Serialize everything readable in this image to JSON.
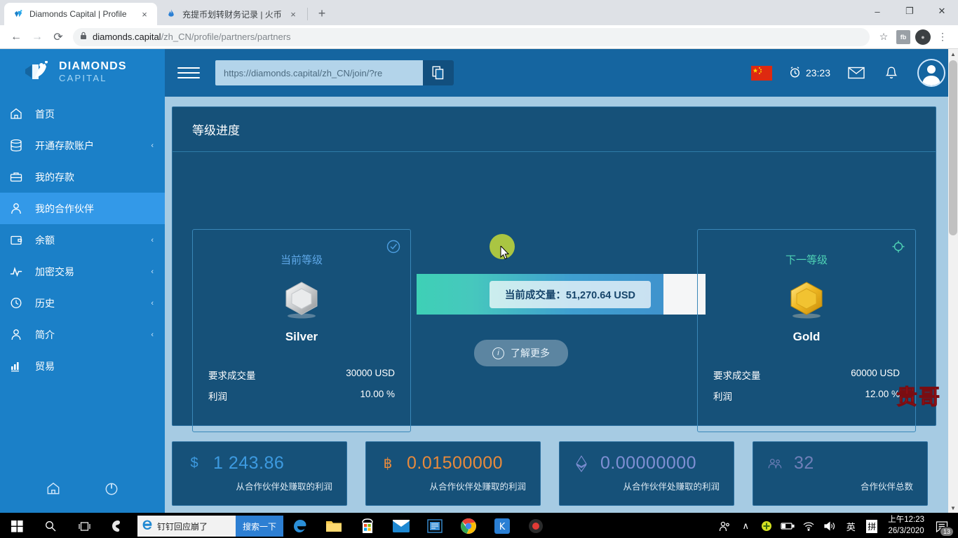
{
  "browser": {
    "tabs": [
      {
        "title": "Diamonds Capital | Profile",
        "favicon": "diamonds-logo-icon",
        "active": true,
        "close_label": "×"
      },
      {
        "title": "充提币划转财务记录 | 火币全球站",
        "favicon": "huobi-flame-icon",
        "active": false,
        "close_label": "×"
      }
    ],
    "new_tab_label": "+",
    "window_controls": {
      "minimize": "–",
      "maximize": "❐",
      "close": "✕"
    },
    "toolbar": {
      "back": "←",
      "forward": "→",
      "reload": "⟳",
      "lock": "🔒",
      "url_domain": "diamonds.capital",
      "url_path": "/zh_CN/profile/partners/partners",
      "bookmark_star": "☆",
      "extension_label": "fb",
      "menu_dots": "⋮"
    }
  },
  "sidebar": {
    "brand": {
      "line1": "DIAMONDS",
      "line2": "CAPITAL"
    },
    "items": [
      {
        "label": "首页",
        "icon": "home-icon",
        "chevron": "",
        "active": false
      },
      {
        "label": "开通存款账户",
        "icon": "database-icon",
        "chevron": "‹",
        "active": false
      },
      {
        "label": "我的存款",
        "icon": "briefcase-icon",
        "chevron": "",
        "active": false
      },
      {
        "label": "我的合作伙伴",
        "icon": "user-icon",
        "chevron": "",
        "active": true
      },
      {
        "label": "余额",
        "icon": "wallet-icon",
        "chevron": "‹",
        "active": false
      },
      {
        "label": "加密交易",
        "icon": "pulse-icon",
        "chevron": "‹",
        "active": false
      },
      {
        "label": "历史",
        "icon": "clock-icon",
        "chevron": "‹",
        "active": false
      },
      {
        "label": "简介",
        "icon": "profile-icon",
        "chevron": "‹",
        "active": false
      },
      {
        "label": "贸易",
        "icon": "chart-bars-icon",
        "chevron": "",
        "active": false
      }
    ],
    "footer": {
      "home_icon": "home-outline-icon",
      "power_icon": "power-icon"
    }
  },
  "topbar": {
    "menu_toggle": "hamburger-icon",
    "referral_link_value": "https://diamonds.capital/zh_CN/join/?re",
    "referral_link_placeholder": "https://diamonds.capital/zh_CN/join/?re",
    "copy_icon": "copy-icon",
    "flag": "cn-flag-icon",
    "clock_icon": "alarm-clock-icon",
    "clock_time": "23:23",
    "mail_icon": "envelope-icon",
    "bell_icon": "bell-icon",
    "avatar_icon": "user-avatar-icon"
  },
  "panel": {
    "title": "等级进度",
    "current_tier": {
      "kicker": "当前等级",
      "name": "Silver",
      "badge_icon": "check-circle-icon",
      "medal_icon": "silver-hex-medal-icon",
      "rows": [
        {
          "label": "要求成交量",
          "value": "30000 USD"
        },
        {
          "label": "利润",
          "value": "10.00 %"
        }
      ]
    },
    "next_tier": {
      "kicker": "下一等级",
      "name": "Gold",
      "badge_icon": "target-circle-icon",
      "medal_icon": "gold-hex-medal-icon",
      "rows": [
        {
          "label": "要求成交量",
          "value": "60000 USD"
        },
        {
          "label": "利润",
          "value": "12.00 %"
        }
      ]
    },
    "progress": {
      "pill_text": "当前成交量：51,270.64 USD",
      "current_volume": 51270.64,
      "min_volume": 30000,
      "max_volume": 60000,
      "percent": 85
    },
    "learn_more": {
      "label": "了解更多",
      "icon": "info-icon"
    }
  },
  "stats": [
    {
      "symbol": "$",
      "symbol_icon": "usd-icon",
      "value": "1 243.86",
      "caption": "从合作伙伴处赚取的利润",
      "color": "#3d9ae0"
    },
    {
      "symbol": "฿",
      "symbol_icon": "btc-icon",
      "value": "0.01500000",
      "caption": "从合作伙伴处赚取的利润",
      "color": "#e88a3c"
    },
    {
      "symbol": "⟠",
      "symbol_icon": "eth-icon",
      "value": "0.00000000",
      "caption": "从合作伙伴处赚取的利润",
      "color": "#7f8fd4"
    },
    {
      "symbol": "👥",
      "symbol_icon": "users-icon",
      "value": "32",
      "caption": "合作伙伴总数",
      "color": "#6f7fb8"
    }
  ],
  "watermark": "贵哥",
  "taskbar": {
    "start_icon": "windows-start-icon",
    "search_icon": "search-icon",
    "taskview_icon": "task-view-icon",
    "cortana_icon": "swirl-icon",
    "search_box": {
      "icon": "ie-icon",
      "text": "钉钉回应崩了",
      "go_label": "搜索一下"
    },
    "pinned": [
      "edge-icon",
      "file-explorer-icon",
      "store-icon",
      "mail-icon",
      "office-icon",
      "chrome-icon",
      "kingsoft-icon",
      "recorder-icon"
    ],
    "tray": {
      "people_icon": "people-icon",
      "chevron_icon": "∧",
      "shield_icon": "security-icon",
      "battery_icon": "battery-icon",
      "wifi_icon": "wifi-icon",
      "volume_icon": "volume-icon",
      "ime_lang": "英",
      "ime_mode": "拼",
      "time": "上午12:23",
      "date": "26/3/2020",
      "notification_icon": "notification-icon",
      "notification_count": "13"
    }
  }
}
